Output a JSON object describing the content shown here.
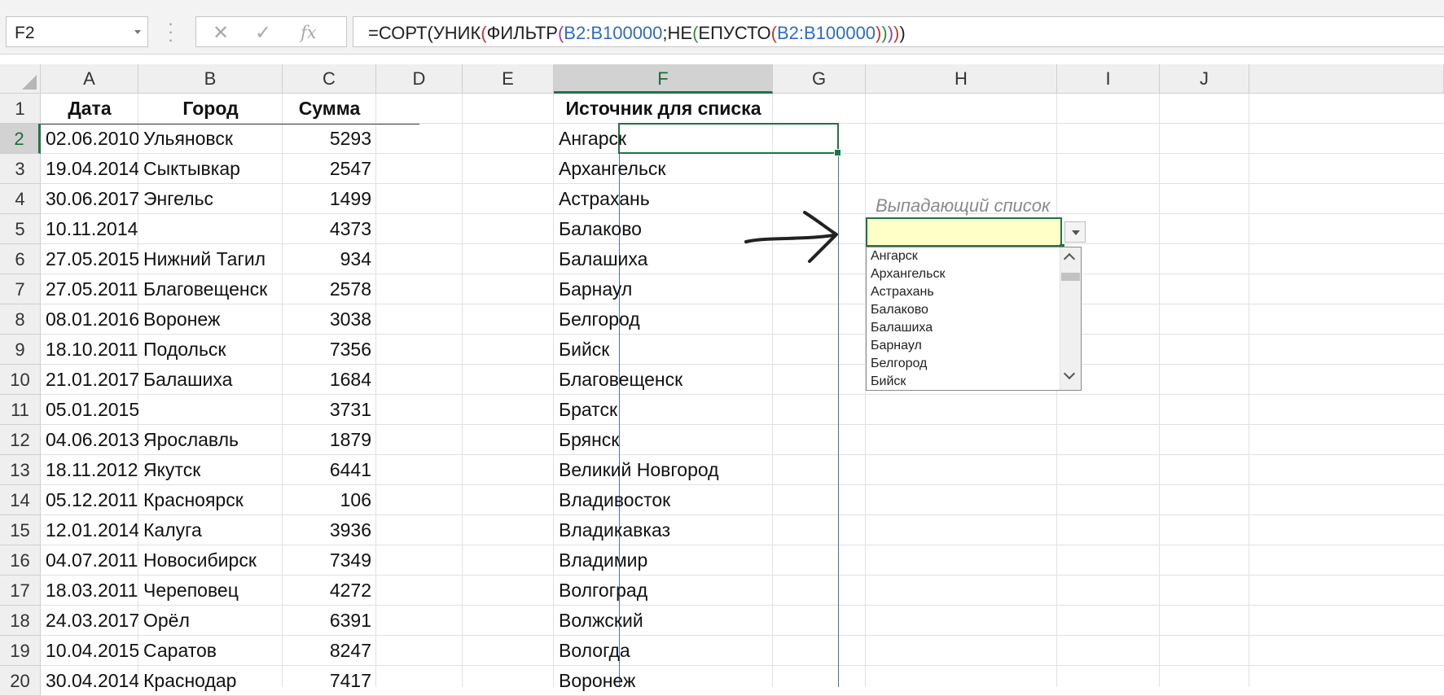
{
  "formula_bar": {
    "name_box": "F2",
    "cancel_glyph": "✕",
    "enter_glyph": "✓",
    "fx_glyph": "fx",
    "formula_parts": [
      {
        "text": "=СОРТ(УНИК",
        "color": "#222222"
      },
      {
        "text": "(",
        "color": "#c0392b"
      },
      {
        "text": "ФИЛЬТР",
        "color": "#222222"
      },
      {
        "text": "(",
        "color": "#8e44ad"
      },
      {
        "text": "B2:B100000",
        "color": "#2e6bc4"
      },
      {
        "text": ";НЕ",
        "color": "#222222"
      },
      {
        "text": "(",
        "color": "#2f8f3a"
      },
      {
        "text": "ЕПУСТО",
        "color": "#222222"
      },
      {
        "text": "(",
        "color": "#c0392b"
      },
      {
        "text": "B2:B100000",
        "color": "#2e6bc4"
      },
      {
        "text": ")",
        "color": "#c0392b"
      },
      {
        "text": ")",
        "color": "#2f8f3a"
      },
      {
        "text": ")",
        "color": "#8e44ad"
      },
      {
        "text": ")",
        "color": "#c0392b"
      },
      {
        "text": ")",
        "color": "#222222"
      }
    ]
  },
  "columns": [
    "A",
    "B",
    "C",
    "D",
    "E",
    "F",
    "G",
    "H",
    "I",
    "J"
  ],
  "selected_column": "F",
  "rows": [
    "1",
    "2",
    "3",
    "4",
    "5",
    "6",
    "7",
    "8",
    "9",
    "10",
    "11",
    "12",
    "13",
    "14",
    "15",
    "16",
    "17",
    "18",
    "19",
    "20"
  ],
  "selected_row": "2",
  "headers": {
    "date": "Дата",
    "city": "Город",
    "sum": "Сумма",
    "source": "Источник для списка"
  },
  "table": [
    [
      "02.06.2010",
      "Ульяновск",
      "5293"
    ],
    [
      "19.04.2014",
      "Сыктывкар",
      "2547"
    ],
    [
      "30.06.2017",
      "Энгельс",
      "1499"
    ],
    [
      "10.11.2014",
      "",
      "4373"
    ],
    [
      "27.05.2015",
      "Нижний Тагил",
      "934"
    ],
    [
      "27.05.2011",
      "Благовещенск",
      "2578"
    ],
    [
      "08.01.2016",
      "Воронеж",
      "3038"
    ],
    [
      "18.10.2011",
      "Подольск",
      "7356"
    ],
    [
      "21.01.2017",
      "Балашиха",
      "1684"
    ],
    [
      "05.01.2015",
      "",
      "3731"
    ],
    [
      "04.06.2013",
      "Ярославль",
      "1879"
    ],
    [
      "18.11.2012",
      "Якутск",
      "6441"
    ],
    [
      "05.12.2011",
      "Красноярск",
      "106"
    ],
    [
      "12.01.2014",
      "Калуга",
      "3936"
    ],
    [
      "04.07.2011",
      "Новосибирск",
      "7349"
    ],
    [
      "18.03.2011",
      "Череповец",
      "4272"
    ],
    [
      "24.03.2017",
      "Орёл",
      "6391"
    ],
    [
      "10.04.2015",
      "Саратов",
      "8247"
    ],
    [
      "30.04.2014",
      "Краснодар",
      "7417"
    ]
  ],
  "source_list": [
    "Ангарск",
    "Архангельск",
    "Астрахань",
    "Балаково",
    "Балашиха",
    "Барнаул",
    "Белгород",
    "Бийск",
    "Благовещенск",
    "Братск",
    "Брянск",
    "Великий Новгород",
    "Владивосток",
    "Владикавказ",
    "Владимир",
    "Волгоград",
    "Волжский",
    "Вологда",
    "Воронеж"
  ],
  "dropdown": {
    "caption": "Выпадающий список",
    "value": "",
    "items": [
      "Ангарск",
      "Архангельск",
      "Астрахань",
      "Балаково",
      "Балашиха",
      "Барнаул",
      "Белгород",
      "Бийск"
    ]
  },
  "colors": {
    "excel_green": "#217346",
    "spill_border": "#4472c4",
    "dropdown_fill": "#ffffc7"
  }
}
